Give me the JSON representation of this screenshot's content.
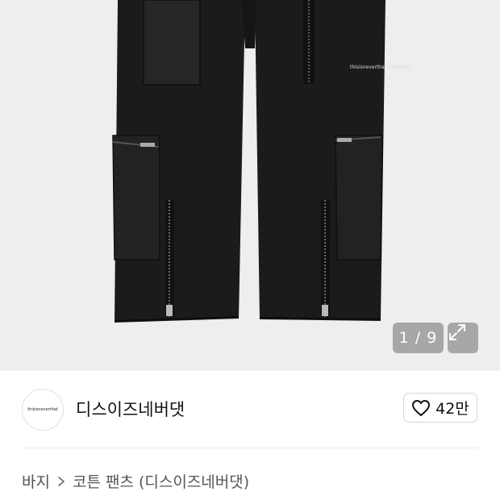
{
  "gallery": {
    "counter": "1 / 9",
    "label_text": "thisisneverthat CHOPARD"
  },
  "brand": {
    "logo_text": "thisisneverthat",
    "name": "디스이즈네버댓",
    "likes": "42만"
  },
  "breadcrumb": {
    "category": "바지",
    "separator": ">",
    "product": "코튼 팬츠 (디스이즈네버댓)"
  },
  "colors": {
    "gallery_bg": "#eeeeee",
    "pants": "#1a1a1a"
  },
  "icons": [
    "expand-icon",
    "heart-icon",
    "chevron-right-icon"
  ]
}
